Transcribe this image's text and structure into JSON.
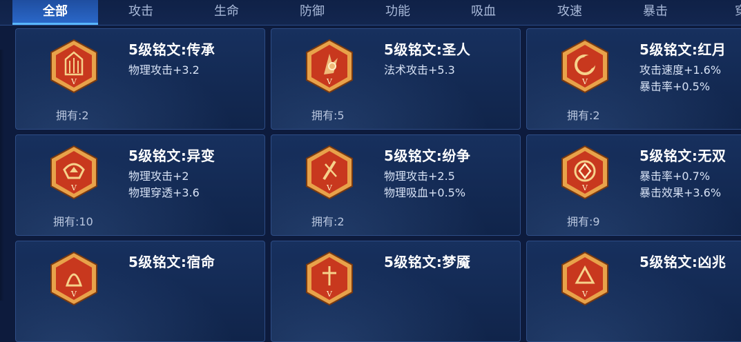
{
  "tabs": [
    "全部",
    "攻击",
    "生命",
    "防御",
    "功能",
    "吸血",
    "攻速",
    "暴击",
    "穿"
  ],
  "active_tab": 0,
  "cards": [
    {
      "name": "5级铭文:传承",
      "stats": [
        "物理攻击+3.2"
      ],
      "owned": "拥有:2",
      "icon": "inscription-chuancheng-icon"
    },
    {
      "name": "5级铭文:圣人",
      "stats": [
        "法术攻击+5.3"
      ],
      "owned": "拥有:5",
      "icon": "inscription-shengren-icon"
    },
    {
      "name": "5级铭文:红月",
      "stats": [
        "攻击速度+1.6%",
        "暴击率+0.5%"
      ],
      "owned": "拥有:2",
      "icon": "inscription-hongyue-icon"
    },
    {
      "name": "5级铭文:异变",
      "stats": [
        "物理攻击+2",
        "物理穿透+3.6"
      ],
      "owned": "拥有:10",
      "icon": "inscription-yibian-icon"
    },
    {
      "name": "5级铭文:纷争",
      "stats": [
        "物理攻击+2.5",
        "物理吸血+0.5%"
      ],
      "owned": "拥有:2",
      "icon": "inscription-fenzheng-icon"
    },
    {
      "name": "5级铭文:无双",
      "stats": [
        "暴击率+0.7%",
        "暴击效果+3.6%"
      ],
      "owned": "拥有:9",
      "icon": "inscription-wushuang-icon"
    },
    {
      "name": "5级铭文:宿命",
      "stats": [],
      "owned": "",
      "icon": "inscription-suming-icon"
    },
    {
      "name": "5级铭文:梦魇",
      "stats": [],
      "owned": "",
      "icon": "inscription-mengyan-icon"
    },
    {
      "name": "5级铭文:凶兆",
      "stats": [],
      "owned": "",
      "icon": "inscription-xiongzhao-icon"
    }
  ],
  "emblem_level": "V",
  "colors": {
    "emblem_outer": "#e8a24a",
    "emblem_inner": "#c8381e",
    "accent": "#2a67c8"
  }
}
